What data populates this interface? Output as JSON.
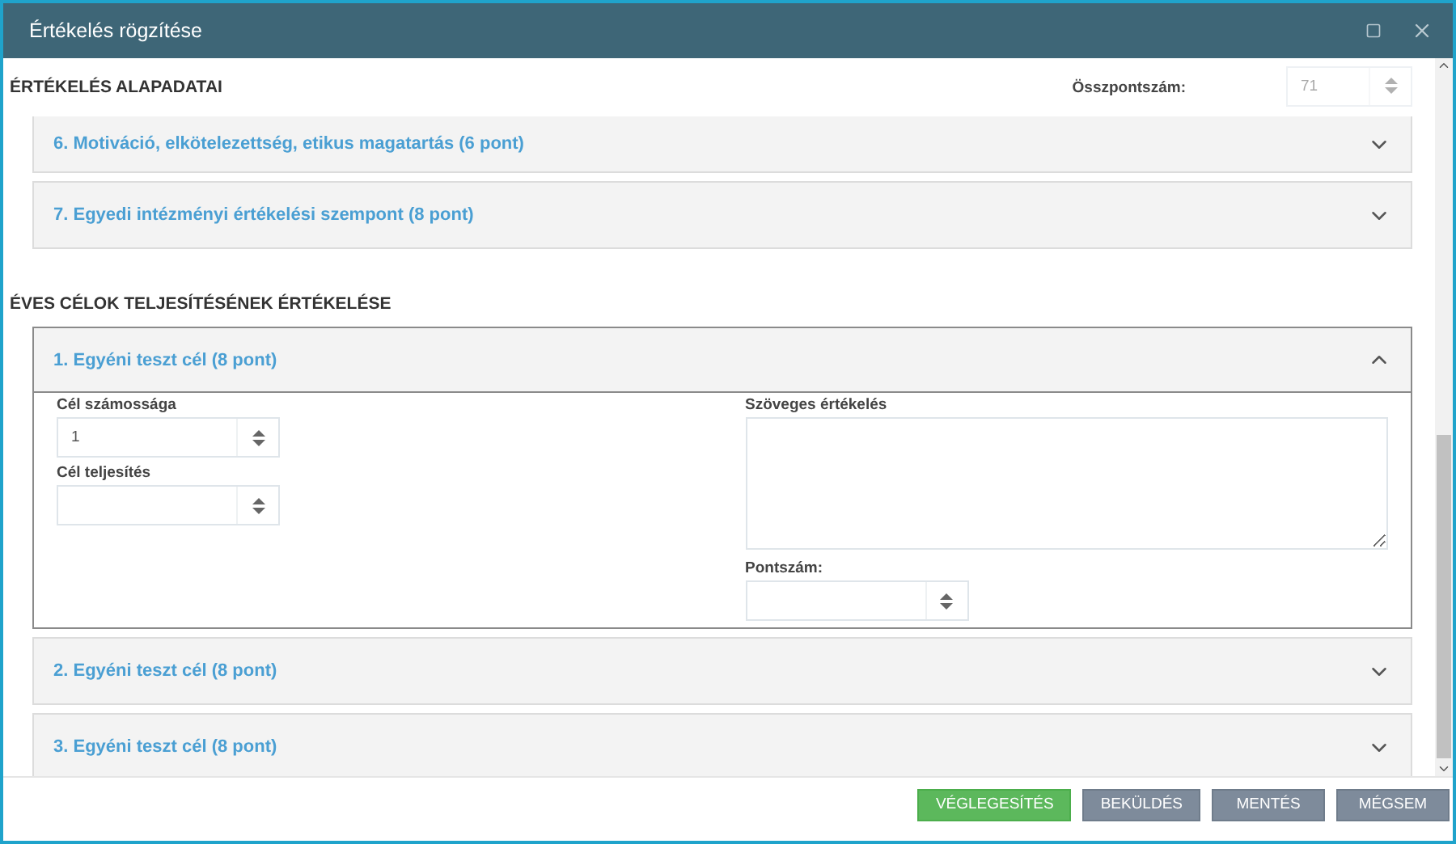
{
  "window": {
    "title": "Értékelés rögzítése"
  },
  "basic": {
    "heading": "ÉRTÉKELÉS ALAPADATAI",
    "total": {
      "label": "Összpontszám:",
      "value": "71",
      "disabled": true
    },
    "sections": [
      {
        "title": "6. Motiváció, elkötelezettség, etikus magatartás (6 pont)",
        "expanded": false
      },
      {
        "title": "7. Egyedi intézményi értékelési szempont (8 pont)",
        "expanded": false
      }
    ]
  },
  "goals": {
    "heading": "ÉVES CÉLOK TELJESÍTÉSÉNEK ÉRTÉKELÉSE",
    "items": [
      {
        "title": "1. Egyéni teszt cél (8 pont)",
        "expanded": true,
        "left": [
          {
            "kind": "number",
            "label": "Cél számossága",
            "value": "1"
          },
          {
            "kind": "number",
            "label": "Cél teljesítés"
          }
        ],
        "right": [
          {
            "kind": "textarea",
            "label": "Szöveges értékelés"
          },
          {
            "kind": "number",
            "label": "Pontszám:"
          }
        ]
      },
      {
        "title": "2. Egyéni teszt cél (8 pont)",
        "expanded": false
      },
      {
        "title": "3. Egyéni teszt cél (8 pont)",
        "expanded": false
      }
    ]
  },
  "buttons": [
    {
      "label": "VÉGLEGESÍTÉS",
      "kind": "primary"
    },
    {
      "label": "BEKÜLDÉS",
      "kind": "secondary"
    },
    {
      "label": "MENTÉS",
      "kind": "secondary"
    },
    {
      "label": "MÉGSEM",
      "kind": "secondary"
    }
  ]
}
